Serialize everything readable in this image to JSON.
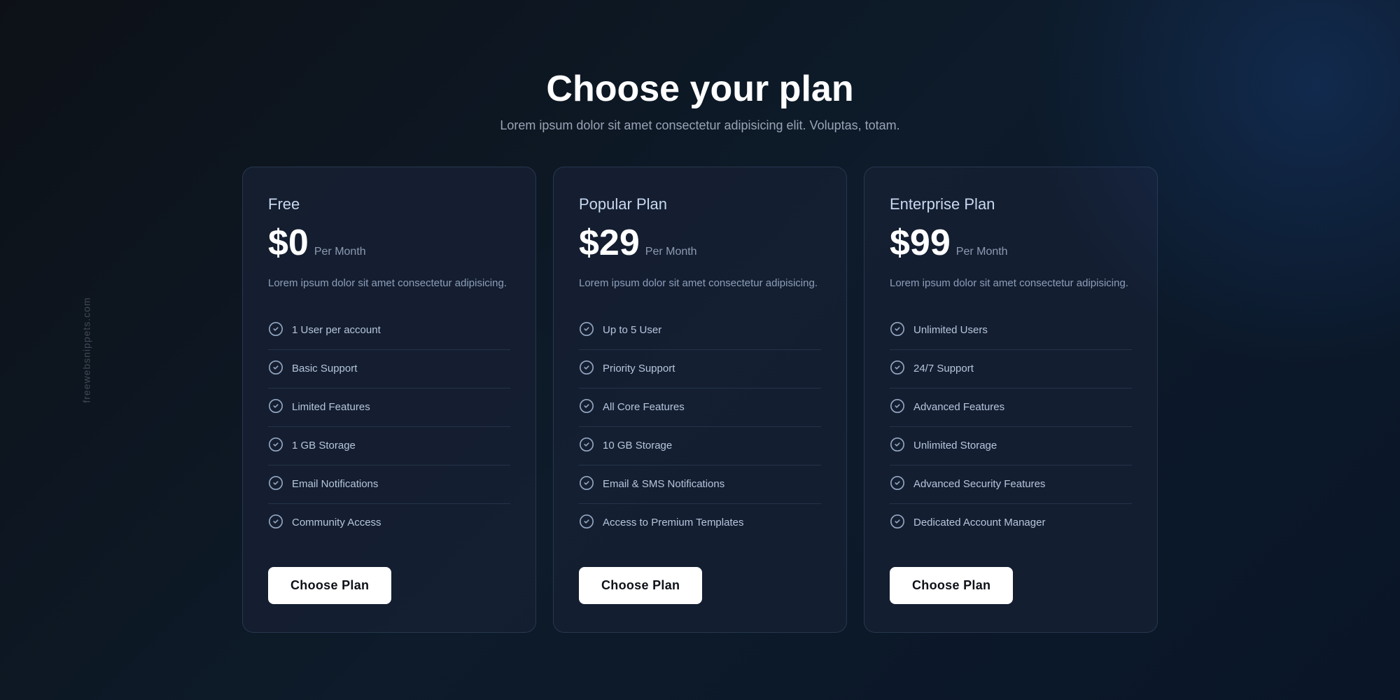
{
  "watermark": {
    "text": "freewebsnippets.com"
  },
  "header": {
    "title": "Choose your plan",
    "subtitle": "Lorem ipsum dolor sit amet consectetur adipisicing elit. Voluptas, totam."
  },
  "plans": [
    {
      "id": "free",
      "name": "Free",
      "price": "$0",
      "period": "Per Month",
      "description": "Lorem ipsum dolor sit amet consectetur adipisicing.",
      "features": [
        "1 User per account",
        "Basic Support",
        "Limited Features",
        "1 GB Storage",
        "Email Notifications",
        "Community Access"
      ],
      "cta": "Choose Plan"
    },
    {
      "id": "popular",
      "name": "Popular Plan",
      "price": "$29",
      "period": "Per Month",
      "description": "Lorem ipsum dolor sit amet consectetur adipisicing.",
      "features": [
        "Up to 5 User",
        "Priority Support",
        "All Core Features",
        "10 GB Storage",
        "Email & SMS Notifications",
        "Access to Premium Templates"
      ],
      "cta": "Choose Plan"
    },
    {
      "id": "enterprise",
      "name": "Enterprise Plan",
      "price": "$99",
      "period": "Per Month",
      "description": "Lorem ipsum dolor sit amet consectetur adipisicing.",
      "features": [
        "Unlimited Users",
        "24/7 Support",
        "Advanced Features",
        "Unlimited Storage",
        "Advanced Security Features",
        "Dedicated Account Manager"
      ],
      "cta": "Choose Plan"
    }
  ]
}
